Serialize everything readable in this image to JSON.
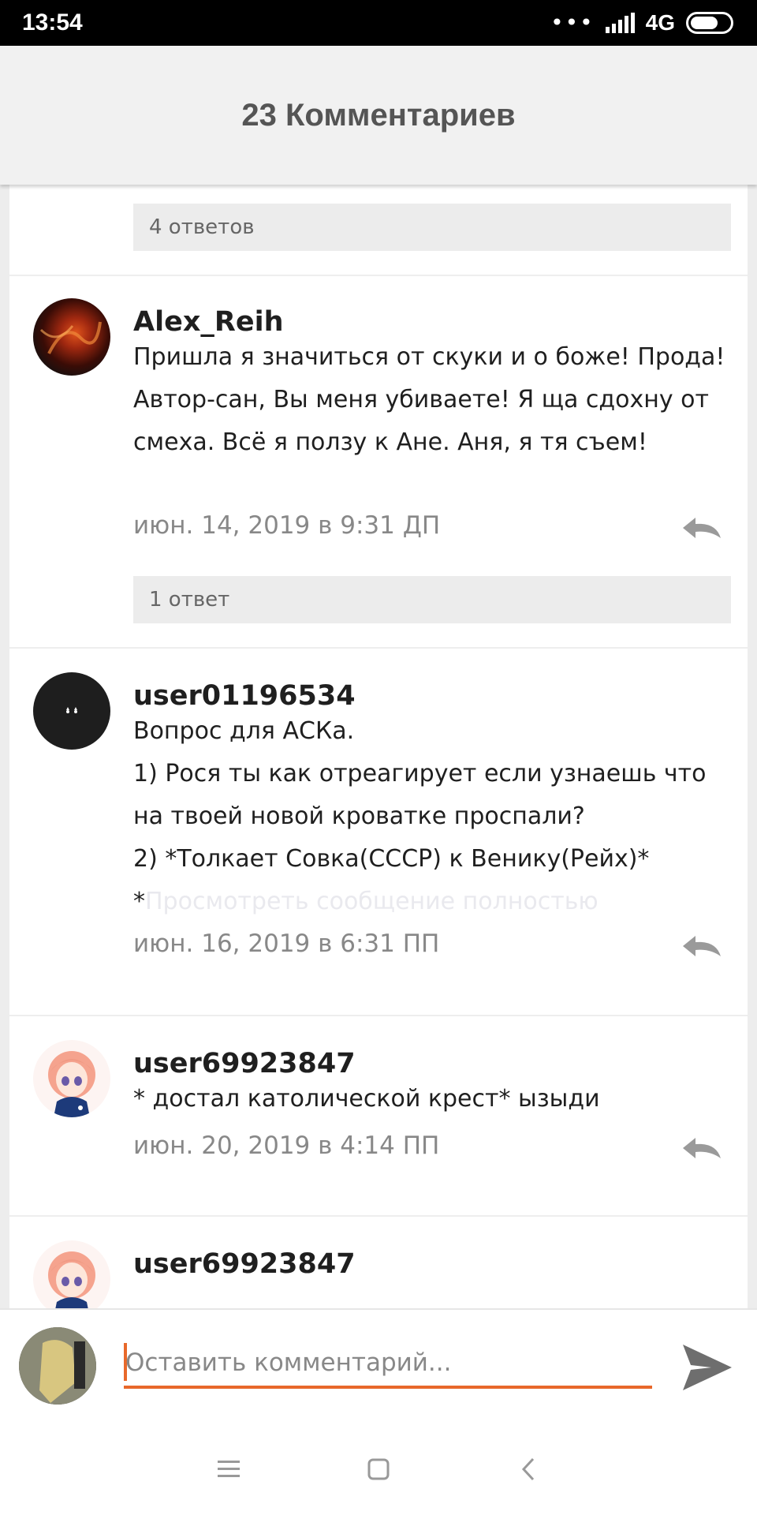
{
  "status_bar": {
    "time": "13:54",
    "network": "4G"
  },
  "header": {
    "title": "23 Комментариев"
  },
  "top_replies": {
    "label": "4 ответов"
  },
  "comments": [
    {
      "author": "Alex_Reih",
      "text": "Пришла я значиться от скуки и о боже! Прода! Автор-сан, Вы меня убиваете! Я ща сдохну от смеха. Всё я ползу к Ане. Аня, я тя съем!",
      "date": "июн. 14, 2019 в 9:31 ДП",
      "replies": "1 ответ"
    },
    {
      "author": "user01196534",
      "text_lines": [
        "Вопрос для АСКа.",
        "1) Рося ты как отреагирует если узнаешь что на твоей новой кроватке проспали?",
        "2) *Толкает Совка(СССР) к Венику(Рейх)*"
      ],
      "text_last_prefix": "*",
      "more_link": "Просмотреть сообщение полностью",
      "date": "июн. 16, 2019 в 6:31 ПП"
    },
    {
      "author": "user69923847",
      "text": "* достал католической крест* ызыди",
      "date": "июн. 20, 2019 в 4:14 ПП"
    },
    {
      "author": "user69923847"
    }
  ],
  "input": {
    "placeholder": "Оставить комментарий..."
  },
  "icons": {
    "reply": "reply-arrow-icon",
    "send": "send-icon",
    "nav": [
      "menu-icon",
      "home-icon",
      "back-icon"
    ]
  },
  "colors": {
    "accent": "#e8682a",
    "date": "#888888",
    "reply_bar": "#ececec"
  }
}
